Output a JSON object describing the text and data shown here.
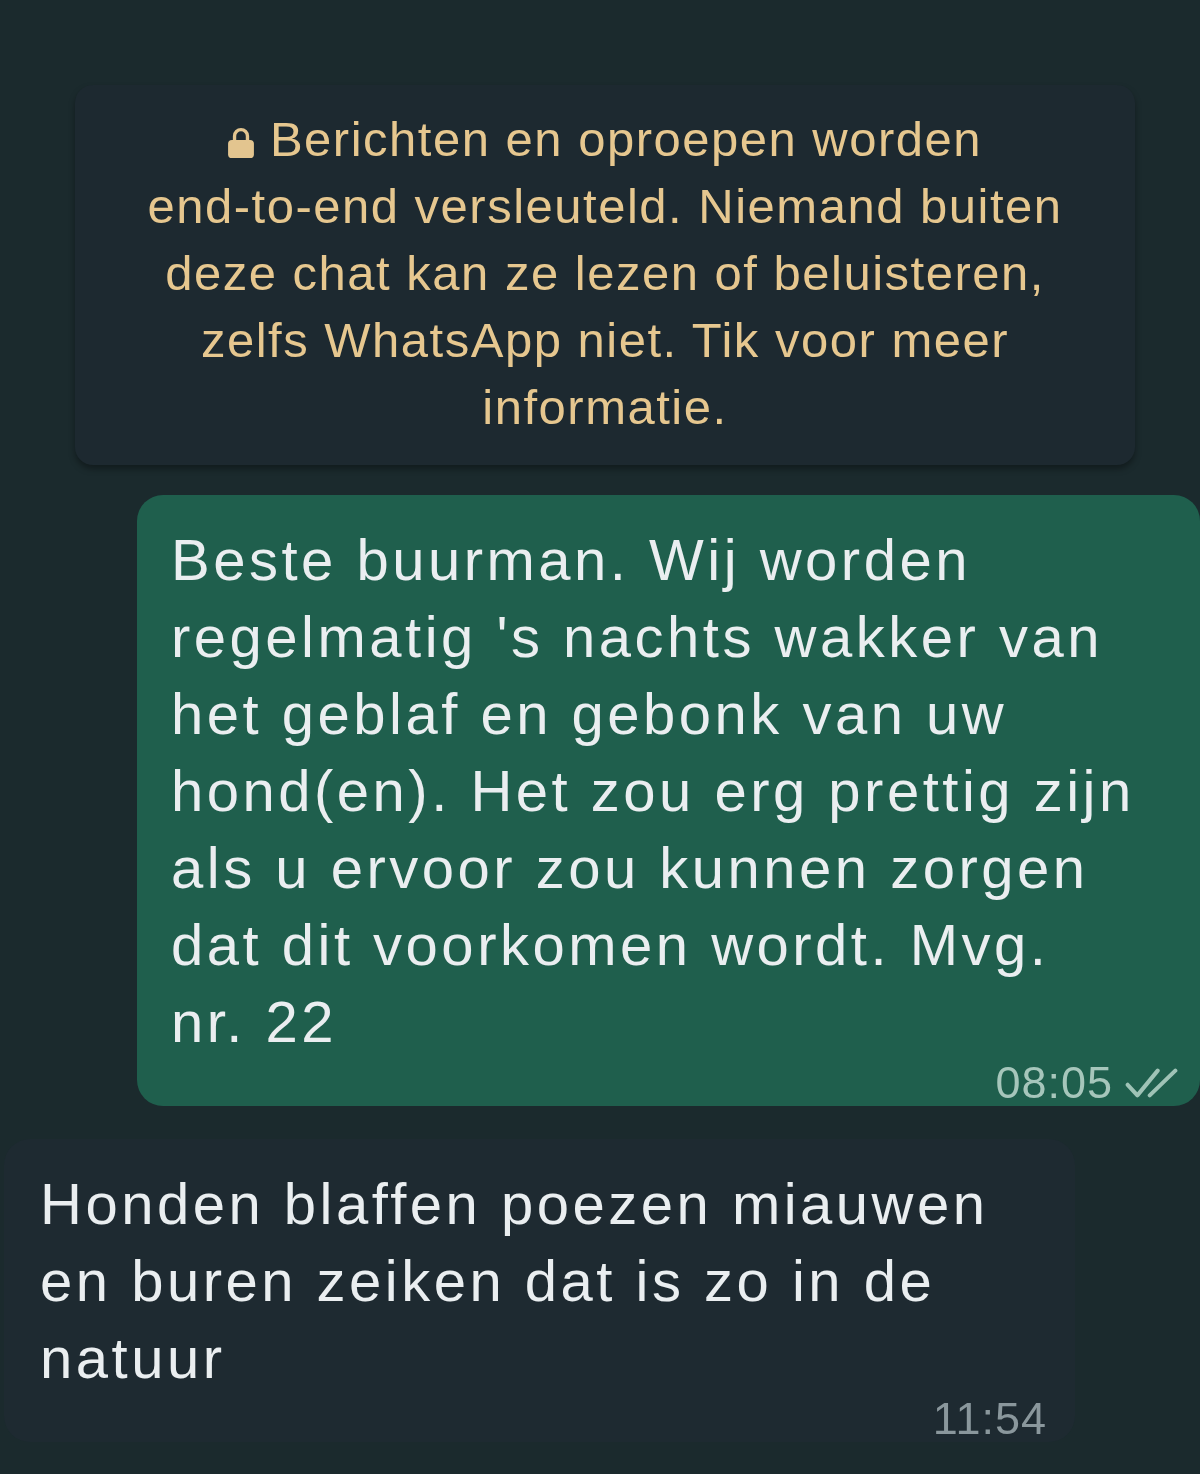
{
  "encryption_notice": {
    "text": "Berichten en oproepen worden\nend-to-end versleuteld. Niemand buiten\ndeze chat kan ze lezen of beluisteren,\nzelfs WhatsApp niet. Tik voor meer\ninformatie."
  },
  "messages": [
    {
      "kind": "outgoing",
      "text": "Beste buurman. Wij worden\nregelmatig 's nachts wakker van\nhet geblaf en gebonk van uw\nhond(en). Het zou erg prettig zijn\nals u ervoor zou kunnen zorgen\ndat dit voorkomen wordt. Mvg.\nnr. 22",
      "time": "08:05",
      "read": false
    },
    {
      "kind": "incoming",
      "text": "Honden blaffen poezen miauwen\nen buren zeiken dat is zo in de\nnatuur",
      "time": "11:54"
    }
  ]
}
